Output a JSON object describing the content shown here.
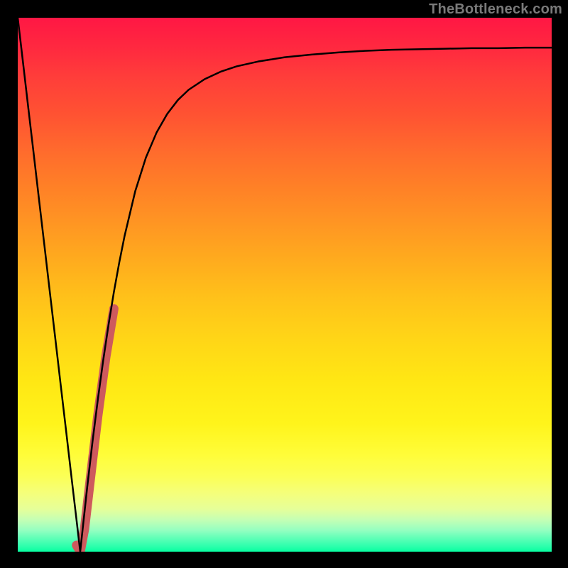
{
  "watermark": "TheBottleneck.com",
  "chart_data": {
    "type": "line",
    "title": "",
    "xlabel": "",
    "ylabel": "",
    "xlim": [
      0,
      100
    ],
    "ylim": [
      0,
      100
    ],
    "grid": false,
    "series": [
      {
        "name": "bottleneck-curve",
        "x": [
          0.0,
          1.0,
          2.0,
          3.0,
          4.0,
          5.0,
          6.0,
          7.0,
          8.0,
          9.0,
          10.0,
          11.0,
          11.7,
          12.0,
          13.0,
          14.0,
          15.0,
          16.0,
          17.0,
          18.0,
          19.0,
          20.0,
          22.0,
          24.0,
          26.0,
          28.0,
          30.0,
          32.0,
          35.0,
          38.0,
          41.0,
          45.0,
          50.0,
          55.0,
          60.0,
          65.0,
          70.0,
          75.0,
          80.0,
          85.0,
          90.0,
          95.0,
          100.0
        ],
        "y": [
          100.0,
          91.5,
          82.9,
          74.4,
          65.8,
          57.3,
          48.7,
          40.2,
          31.6,
          23.1,
          14.5,
          6.0,
          0.0,
          2.8,
          12.0,
          20.6,
          28.5,
          35.8,
          42.5,
          48.6,
          54.1,
          59.1,
          67.5,
          73.8,
          78.5,
          82.0,
          84.6,
          86.5,
          88.5,
          89.9,
          90.9,
          91.8,
          92.6,
          93.1,
          93.5,
          93.8,
          94.0,
          94.1,
          94.2,
          94.3,
          94.3,
          94.4,
          94.4
        ]
      },
      {
        "name": "recommended-range-highlight",
        "x": [
          11.0,
          11.5,
          11.7,
          12.5,
          13.5,
          15.0,
          16.5,
          18.0
        ],
        "y": [
          1.2,
          0.4,
          0.0,
          4.2,
          12.8,
          25.5,
          36.5,
          45.5
        ]
      }
    ],
    "background_gradient_stops": [
      {
        "pct": 0,
        "color": "#ff1744"
      },
      {
        "pct": 25,
        "color": "#ff6b2d"
      },
      {
        "pct": 50,
        "color": "#ffc01a"
      },
      {
        "pct": 75,
        "color": "#fff41b"
      },
      {
        "pct": 92,
        "color": "#e6ff99"
      },
      {
        "pct": 100,
        "color": "#08ffa1"
      }
    ]
  }
}
